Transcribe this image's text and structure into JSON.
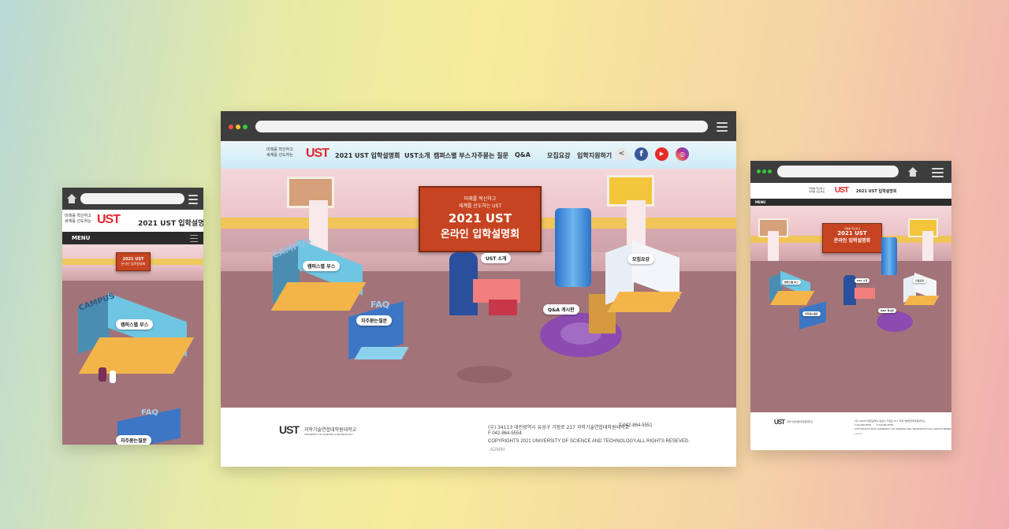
{
  "header": {
    "logo_text": "UST",
    "logo_slogan_line1": "미래를 혁신하고",
    "logo_slogan_line2": "세계를 선도하는",
    "site_title": "2021 UST 입학설명회",
    "nav": [
      "UST소개",
      "캠퍼스별 부스",
      "자주묻는 질문",
      "Q&A",
      "모집요강",
      "입학지원하기"
    ],
    "social": [
      "share-icon",
      "facebook-icon",
      "youtube-icon",
      "instagram-icon"
    ],
    "colors": {
      "facebook": "#3b5998",
      "youtube": "#e52d27",
      "instagram": "#c13584",
      "accent": "#e3262d"
    }
  },
  "hero": {
    "banner_line1": "미래를 혁신하고",
    "banner_line2": "세계를 선도하는 UST",
    "banner_title1": "2021 UST",
    "banner_title2": "온라인 입학설명회"
  },
  "booths": {
    "campus": "캠퍼스별 부스",
    "faq": "자주묻는질문",
    "ust_intro": "UST 소개",
    "qna": "Q&A 게시판",
    "recruit": "모집요강"
  },
  "footer": {
    "logo_text": "UST",
    "org_name": "과학기술연합대학원대학교",
    "org_name_en": "UNIVERSITY OF SCIENCE & TECHNOLOGY",
    "address": "(우) 34113 대전광역시 유성구 가정로 217 과학기술연합대학원대학교",
    "tel": "T 042-864-5551",
    "fax": "F 042-864-5554",
    "copyright": "COPYRIGHTS 2021 UNIVERSITY OF SCIENCE AND TECHNOLOGY.ALL RIGHTS RESEVED.",
    "admin": "ADMIN"
  },
  "mobile": {
    "menu_label": "MENU"
  }
}
